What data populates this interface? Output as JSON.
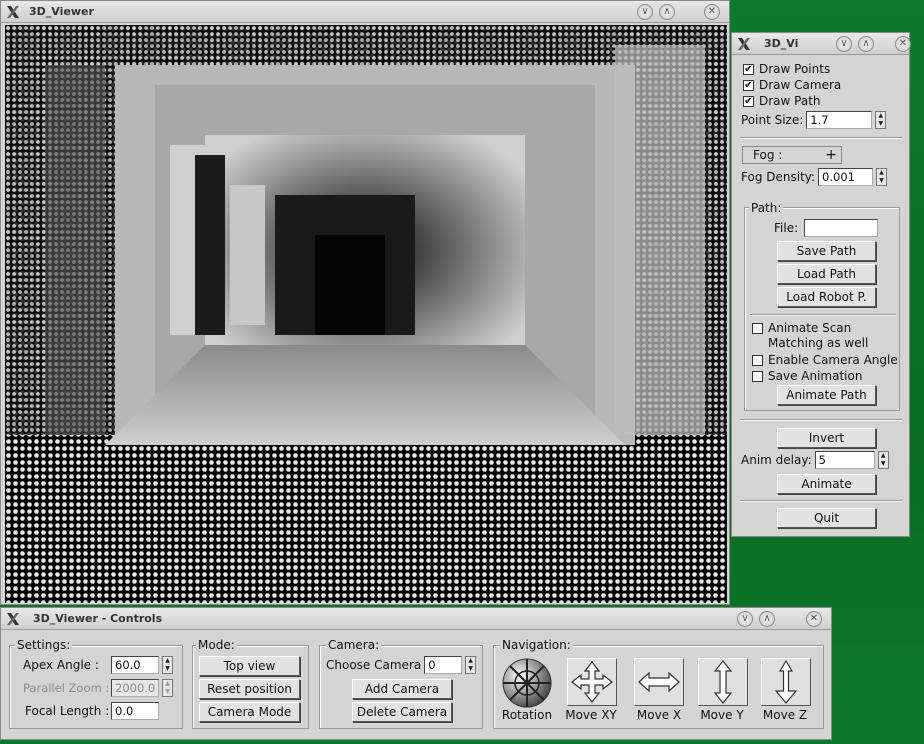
{
  "viewer": {
    "title": "3D_Viewer"
  },
  "panel": {
    "title": "3D_Vi",
    "draw_points": "Draw Points",
    "draw_camera": "Draw Camera",
    "draw_path": "Draw Path",
    "point_size_label": "Point Size:",
    "point_size_value": "1.7",
    "fog_label": "Fog :",
    "fog_density_label": "Fog Density:",
    "fog_density_value": "0.001",
    "path_group": "Path:",
    "file_label": "File:",
    "file_value": "",
    "save_path": "Save Path",
    "load_path": "Load Path",
    "load_robot": "Load Robot P.",
    "animate_scan": "Animate Scan",
    "matching": "Matching as well",
    "enable_cam_angle": "Enable Camera Angle",
    "save_animation": "Save Animation",
    "animate_path": "Animate Path",
    "invert": "Invert",
    "anim_delay_label": "Anim delay:",
    "anim_delay_value": "5",
    "animate": "Animate",
    "quit": "Quit",
    "checked": {
      "draw_points": true,
      "draw_camera": true,
      "draw_path": true,
      "animate_scan": false,
      "enable_cam_angle": false,
      "save_animation": false
    }
  },
  "controls": {
    "title": "3D_Viewer - Controls",
    "settings_label": "Settings:",
    "apex_label": "Apex Angle :",
    "apex_value": "60.0",
    "parallel_label": "Parallel Zoom :",
    "parallel_value": "2000.0",
    "focal_label": "Focal Length :",
    "focal_value": "0.0",
    "mode_label": "Mode:",
    "top_view": "Top view",
    "reset_position": "Reset position",
    "camera_mode": "Camera Mode",
    "camera_label": "Camera:",
    "choose_camera": "Choose Camera",
    "camera_value": "0",
    "add_camera": "Add Camera",
    "delete_camera": "Delete Camera",
    "navigation_label": "Navigation:",
    "nav": [
      "Rotation",
      "Move XY",
      "Move X",
      "Move Y",
      "Move Z"
    ]
  },
  "colors": {
    "desktop": "#0e7a2c",
    "window": "#d4d4d4"
  }
}
